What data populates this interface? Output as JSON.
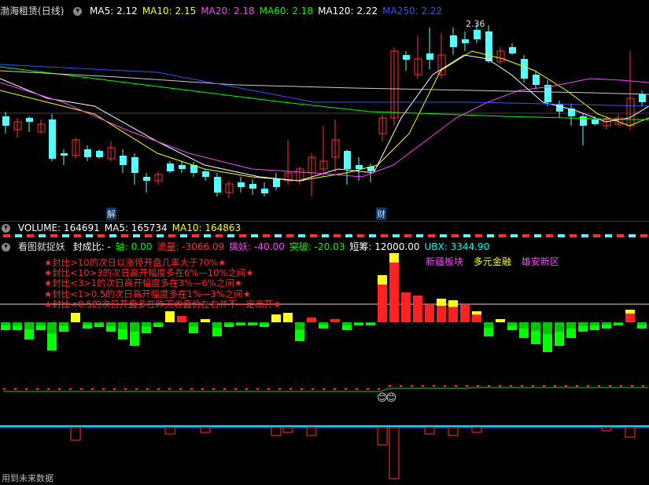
{
  "main_header": {
    "stock_name": "渤海租赁",
    "period": "(日线)",
    "indicators": [
      {
        "label": "MA5: 2.12",
        "color": "#ffffff"
      },
      {
        "label": "MA10: 2.15",
        "color": "#ffff00"
      },
      {
        "label": "MA20: 2.18",
        "color": "#ff44ff"
      },
      {
        "label": "MA60: 2.18",
        "color": "#00ff00"
      },
      {
        "label": "MA120: 2.22",
        "color": "#ffffff"
      },
      {
        "label": "MA250: 2.22",
        "color": "#3355ff"
      }
    ]
  },
  "price_chart": {
    "high_label": "2.36",
    "event_markers": [
      "解",
      "财"
    ]
  },
  "volume_header": {
    "items": [
      {
        "label": "VOLUME: 164691",
        "color": "#ffffff"
      },
      {
        "label": "MA5: 165734",
        "color": "#ffffff"
      },
      {
        "label": "MA10: 164863",
        "color": "#ffff00"
      }
    ]
  },
  "indicator_header": {
    "title": "看图就捉妖",
    "items": [
      {
        "label": "封成比: -",
        "color": "#ffffff"
      },
      {
        "label": "轴: 0.00",
        "color": "#00ff00"
      },
      {
        "label": "流量: -3066.09",
        "color": "#ff3333"
      },
      {
        "label": "擒妖: -40.00",
        "color": "#ff44ff"
      },
      {
        "label": "突破: -20.03",
        "color": "#00ff00"
      },
      {
        "label": "短筹: 12000.00",
        "color": "#ffffff"
      },
      {
        "label": "UBX: 3344.90",
        "color": "#00ffff"
      }
    ]
  },
  "legend_lines": [
    "★封比>10的次日以涨停开盘几率大于70%★",
    "★封比<10>3的次日高开幅度多在6%—10%之间★",
    "★封比<3>1的次日高开幅度多在3%—6%之间★",
    "★封比<1>0.5的次日高开幅度多在1%—3%之间★",
    "★封比<0.5的次日开盘多在昨天收盘价左右并不一定高开★"
  ],
  "sector_tags": [
    {
      "label": "新疆板块",
      "color": "#ff44ff"
    },
    {
      "label": "多元金融",
      "color": "#ffff00"
    },
    {
      "label": "雄安新区",
      "color": "#ff44ff"
    }
  ],
  "emoji_marker": "😊😊",
  "footer_text": "用到未来数据"
}
